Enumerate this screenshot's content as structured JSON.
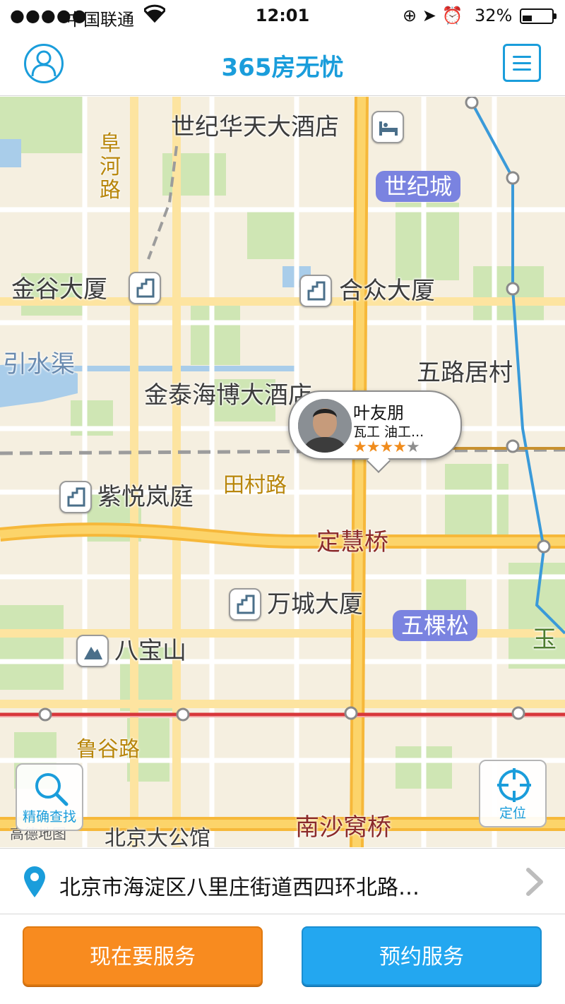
{
  "status_bar": {
    "signal": "●●●●●",
    "carrier": "中国联通",
    "time": "12:01",
    "icons": "⊕ ➤ ⏰",
    "battery_percent": "32%",
    "battery_level": 0.32
  },
  "nav": {
    "title": "365房无忧",
    "profile_icon": "user-outline-icon",
    "menu_icon": "hamburger-menu-icon",
    "accent_color": "#1a9ddb"
  },
  "map": {
    "labels": {
      "hotel_shijihuatian": "世纪华天大酒店",
      "fuhe_road": "阜河路",
      "shijicheng": "世纪城",
      "jingu_building": "金谷大厦",
      "hezhong_building": "合众大厦",
      "yinshuiqu": "引水渠",
      "wulujucun": "五路居村",
      "jintaihaibo_hotel": "金泰海博大酒店",
      "ziyuelanting": "紫悦岚庭",
      "tiancun_road": "田村路",
      "dinghui_bridge": "定慧桥",
      "wancheng_building": "万城大厦",
      "wukesong": "五棵松",
      "babaoshan": "八宝山",
      "lugu_road": "鲁谷路",
      "nanshawo_bridge": "南沙窝桥",
      "beijing_hotel": "北京大公馆",
      "yu_edge": "玉",
      "attribution": "高德地图"
    },
    "worker": {
      "name": "叶友朋",
      "skills": "瓦工 油工...",
      "rating": 4,
      "rating_max": 5
    },
    "search_button_label": "精确查找",
    "locate_button_label": "定位"
  },
  "address": {
    "text": "北京市海淀区八里庄街道西四环北路…"
  },
  "buttons": {
    "service_now": "现在要服务",
    "book_service": "预约服务",
    "service_now_color": "#f88b1f",
    "book_service_color": "#23a7f0"
  }
}
